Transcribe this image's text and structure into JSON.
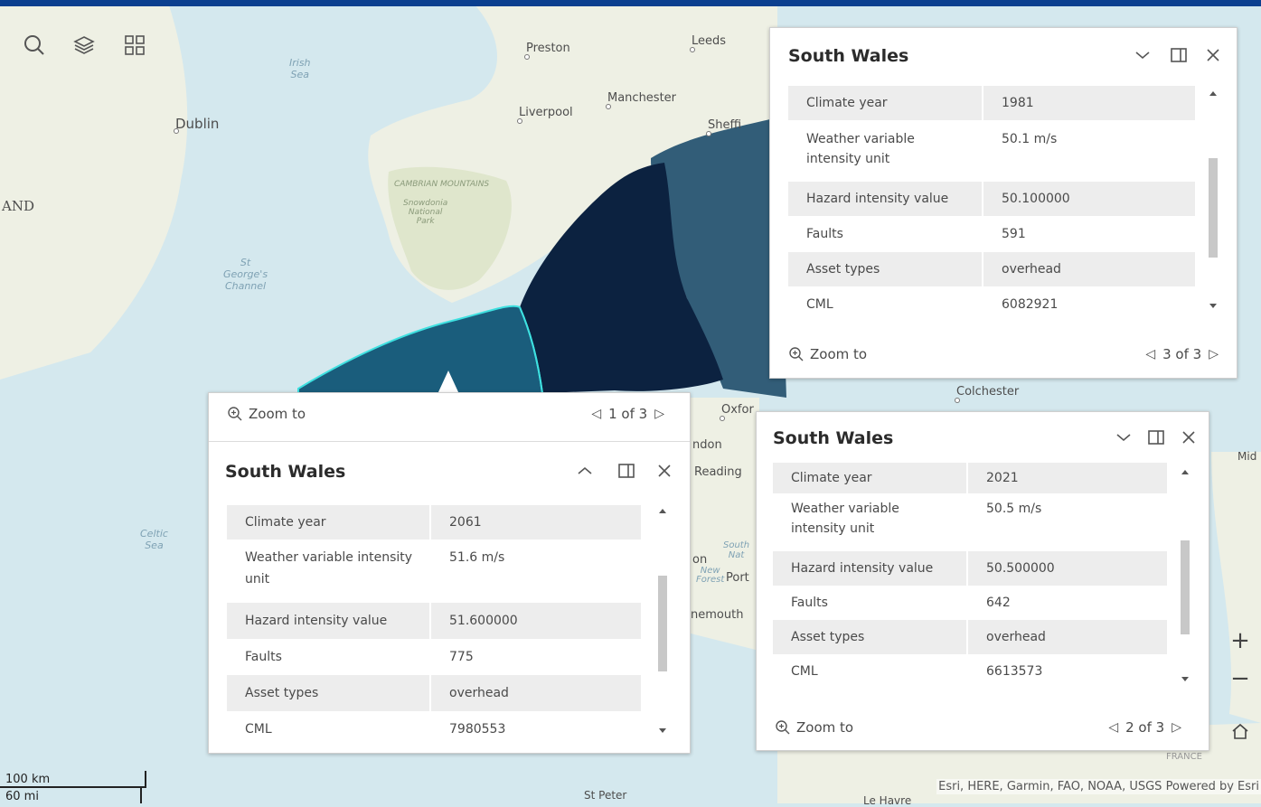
{
  "map": {
    "labels": {
      "irish_sea": "Irish\nSea",
      "dublin": "Dublin",
      "and": "AND",
      "preston": "Preston",
      "leeds": "Leeds",
      "manchester": "Manchester",
      "liverpool": "Liverpool",
      "sheffield": "Sheffi",
      "cambrian": "CAMBRIAN MOUNTAINS",
      "snowdonia": "Snowdonia\nNational\nPark",
      "st_georges": "St\nGeorge's\nChannel",
      "celtic_sea": "Celtic\nSea",
      "colchester": "Colchester",
      "oxford": "Oxfor",
      "london": "ndon",
      "reading": "Reading",
      "southampton": "on",
      "new_forest": "New\nForest",
      "portsmouth": "Port",
      "south_downs": "South\nNat",
      "bournemouth": "nemouth",
      "mid": "Mid",
      "france": "FRANCE",
      "st_peter": "St Peter",
      "le_havre": "Le Havre"
    },
    "colors": {
      "sea": "#d4e8ee",
      "land": "#eef0e4",
      "region_dark": "#0c2240",
      "region_mid": "#1a5d7c",
      "region_slate": "#325d78",
      "region_border": "#3ee0e0"
    },
    "scale": {
      "km": "100 km",
      "mi": "60 mi"
    },
    "attribution": "Esri, HERE, Garmin, FAO, NOAA, USGS   Powered by Esri"
  },
  "toolbar": {
    "search_icon": "search-icon",
    "layers_icon": "layers-icon",
    "qr_icon": "qr-code-icon"
  },
  "controls": {
    "zoom_in": "+",
    "zoom_out": "−",
    "home_icon": "home-icon"
  },
  "popups": [
    {
      "title": "South Wales",
      "rows": [
        {
          "k": "Climate year",
          "v": "1981"
        },
        {
          "k": "Weather variable intensity unit",
          "v": "50.1 m/s"
        },
        {
          "k": "Hazard intensity value",
          "v": "50.100000"
        },
        {
          "k": "Faults",
          "v": "591"
        },
        {
          "k": "Asset types",
          "v": "overhead"
        },
        {
          "k": "CML",
          "v": "6082921"
        }
      ],
      "zoom_label": "Zoom to",
      "pager": "3 of 3"
    },
    {
      "title": "South Wales",
      "rows": [
        {
          "k": "Climate year",
          "v": "2021"
        },
        {
          "k": "Weather variable intensity unit",
          "v": "50.5 m/s"
        },
        {
          "k": "Hazard intensity value",
          "v": "50.500000"
        },
        {
          "k": "Faults",
          "v": "642"
        },
        {
          "k": "Asset types",
          "v": "overhead"
        },
        {
          "k": "CML",
          "v": "6613573"
        }
      ],
      "zoom_label": "Zoom to",
      "pager": "2 of 3"
    },
    {
      "title": "South Wales",
      "rows": [
        {
          "k": "Climate year",
          "v": "2061"
        },
        {
          "k": "Weather variable intensity unit",
          "v": "51.6 m/s"
        },
        {
          "k": "Hazard intensity value",
          "v": "51.600000"
        },
        {
          "k": "Faults",
          "v": "775"
        },
        {
          "k": "Asset types",
          "v": "overhead"
        },
        {
          "k": "CML",
          "v": "7980553"
        }
      ],
      "zoom_label": "Zoom to",
      "pager": "1 of 3"
    }
  ]
}
